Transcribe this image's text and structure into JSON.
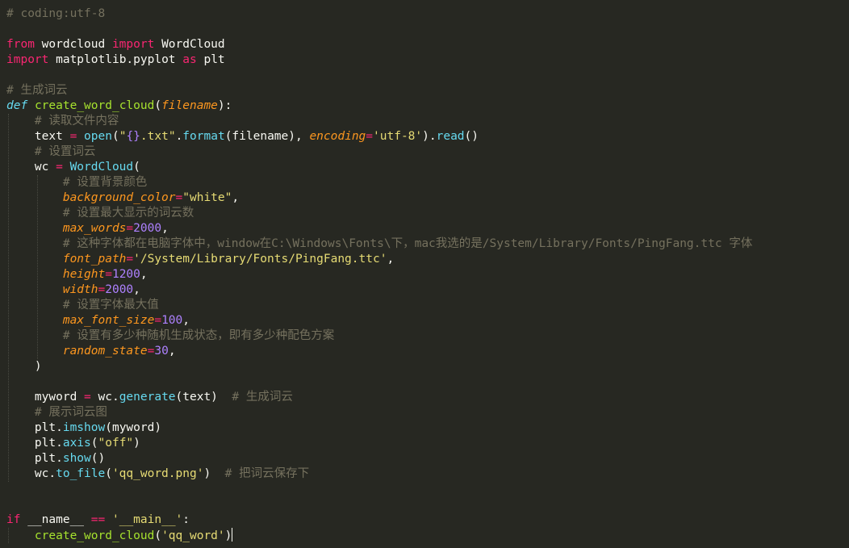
{
  "editor": {
    "lines": [
      {
        "tokens": [
          {
            "c": "cm",
            "t": "# coding:utf-8"
          }
        ]
      },
      {
        "tokens": []
      },
      {
        "tokens": [
          {
            "c": "kw",
            "t": "from"
          },
          {
            "c": "tx",
            "t": " wordcloud "
          },
          {
            "c": "kw",
            "t": "import"
          },
          {
            "c": "tx",
            "t": " WordCloud"
          }
        ]
      },
      {
        "tokens": [
          {
            "c": "kw",
            "t": "import"
          },
          {
            "c": "tx",
            "t": " matplotlib.pyplot "
          },
          {
            "c": "kw",
            "t": "as"
          },
          {
            "c": "tx",
            "t": " plt"
          }
        ]
      },
      {
        "tokens": []
      },
      {
        "tokens": [
          {
            "c": "cm",
            "t": "# 生成词云"
          }
        ]
      },
      {
        "tokens": [
          {
            "c": "df",
            "t": "def"
          },
          {
            "c": "tx",
            "t": " "
          },
          {
            "c": "fn",
            "t": "create_word_cloud"
          },
          {
            "c": "tx",
            "t": "("
          },
          {
            "c": "pa",
            "t": "filename"
          },
          {
            "c": "tx",
            "t": "):"
          }
        ]
      },
      {
        "tokens": [
          {
            "c": "tx",
            "t": "    "
          },
          {
            "c": "cm",
            "t": "# 读取文件内容"
          }
        ]
      },
      {
        "tokens": [
          {
            "c": "tx",
            "t": "    text "
          },
          {
            "c": "kw",
            "t": "="
          },
          {
            "c": "tx",
            "t": " "
          },
          {
            "c": "bi",
            "t": "open"
          },
          {
            "c": "tx",
            "t": "("
          },
          {
            "c": "st",
            "t": "\""
          },
          {
            "c": "nm",
            "t": "{}"
          },
          {
            "c": "st",
            "t": ".txt\""
          },
          {
            "c": "tx",
            "t": "."
          },
          {
            "c": "bi",
            "t": "format"
          },
          {
            "c": "tx",
            "t": "(filename), "
          },
          {
            "c": "pa",
            "t": "encoding"
          },
          {
            "c": "kw",
            "t": "="
          },
          {
            "c": "st",
            "t": "'utf-8'"
          },
          {
            "c": "tx",
            "t": ")."
          },
          {
            "c": "bi",
            "t": "read"
          },
          {
            "c": "tx",
            "t": "()"
          }
        ]
      },
      {
        "tokens": [
          {
            "c": "tx",
            "t": "    "
          },
          {
            "c": "cm",
            "t": "# 设置词云"
          }
        ]
      },
      {
        "tokens": [
          {
            "c": "tx",
            "t": "    wc "
          },
          {
            "c": "kw",
            "t": "="
          },
          {
            "c": "tx",
            "t": " "
          },
          {
            "c": "bi",
            "t": "WordCloud"
          },
          {
            "c": "tx",
            "t": "("
          }
        ]
      },
      {
        "tokens": [
          {
            "c": "tx",
            "t": "        "
          },
          {
            "c": "cm",
            "t": "# 设置背景颜色"
          }
        ]
      },
      {
        "tokens": [
          {
            "c": "tx",
            "t": "        "
          },
          {
            "c": "pa",
            "t": "background_color"
          },
          {
            "c": "kw",
            "t": "="
          },
          {
            "c": "st",
            "t": "\"white\""
          },
          {
            "c": "tx",
            "t": ","
          }
        ]
      },
      {
        "tokens": [
          {
            "c": "tx",
            "t": "        "
          },
          {
            "c": "cm",
            "t": "# 设置最大显示的词云数"
          }
        ]
      },
      {
        "tokens": [
          {
            "c": "tx",
            "t": "        "
          },
          {
            "c": "pa",
            "t": "max_words"
          },
          {
            "c": "kw",
            "t": "="
          },
          {
            "c": "nm",
            "t": "2000"
          },
          {
            "c": "tx",
            "t": ","
          }
        ]
      },
      {
        "tokens": [
          {
            "c": "tx",
            "t": "        "
          },
          {
            "c": "cm",
            "t": "# 这种字体都在电脑字体中，window在C:\\Windows\\Fonts\\下，mac我选的是/System/Library/Fonts/PingFang.ttc 字体"
          }
        ]
      },
      {
        "tokens": [
          {
            "c": "tx",
            "t": "        "
          },
          {
            "c": "pa",
            "t": "font_path"
          },
          {
            "c": "kw",
            "t": "="
          },
          {
            "c": "st",
            "t": "'/System/Library/Fonts/PingFang.ttc'"
          },
          {
            "c": "tx",
            "t": ","
          }
        ]
      },
      {
        "tokens": [
          {
            "c": "tx",
            "t": "        "
          },
          {
            "c": "pa",
            "t": "height"
          },
          {
            "c": "kw",
            "t": "="
          },
          {
            "c": "nm",
            "t": "1200"
          },
          {
            "c": "tx",
            "t": ","
          }
        ]
      },
      {
        "tokens": [
          {
            "c": "tx",
            "t": "        "
          },
          {
            "c": "pa",
            "t": "width"
          },
          {
            "c": "kw",
            "t": "="
          },
          {
            "c": "nm",
            "t": "2000"
          },
          {
            "c": "tx",
            "t": ","
          }
        ]
      },
      {
        "tokens": [
          {
            "c": "tx",
            "t": "        "
          },
          {
            "c": "cm",
            "t": "# 设置字体最大值"
          }
        ]
      },
      {
        "tokens": [
          {
            "c": "tx",
            "t": "        "
          },
          {
            "c": "pa",
            "t": "max_font_size"
          },
          {
            "c": "kw",
            "t": "="
          },
          {
            "c": "nm",
            "t": "100"
          },
          {
            "c": "tx",
            "t": ","
          }
        ]
      },
      {
        "tokens": [
          {
            "c": "tx",
            "t": "        "
          },
          {
            "c": "cm",
            "t": "# 设置有多少种随机生成状态，即有多少种配色方案"
          }
        ]
      },
      {
        "tokens": [
          {
            "c": "tx",
            "t": "        "
          },
          {
            "c": "pa",
            "t": "random_state"
          },
          {
            "c": "kw",
            "t": "="
          },
          {
            "c": "nm",
            "t": "30"
          },
          {
            "c": "tx",
            "t": ","
          }
        ]
      },
      {
        "tokens": [
          {
            "c": "tx",
            "t": "    )"
          }
        ]
      },
      {
        "tokens": []
      },
      {
        "tokens": [
          {
            "c": "tx",
            "t": "    myword "
          },
          {
            "c": "kw",
            "t": "="
          },
          {
            "c": "tx",
            "t": " wc."
          },
          {
            "c": "bi",
            "t": "generate"
          },
          {
            "c": "tx",
            "t": "(text)  "
          },
          {
            "c": "cm",
            "t": "# 生成词云"
          }
        ]
      },
      {
        "tokens": [
          {
            "c": "tx",
            "t": "    "
          },
          {
            "c": "cm",
            "t": "# 展示词云图"
          }
        ]
      },
      {
        "tokens": [
          {
            "c": "tx",
            "t": "    plt."
          },
          {
            "c": "bi",
            "t": "imshow"
          },
          {
            "c": "tx",
            "t": "(myword)"
          }
        ]
      },
      {
        "tokens": [
          {
            "c": "tx",
            "t": "    plt."
          },
          {
            "c": "bi",
            "t": "axis"
          },
          {
            "c": "tx",
            "t": "("
          },
          {
            "c": "st",
            "t": "\"off\""
          },
          {
            "c": "tx",
            "t": ")"
          }
        ]
      },
      {
        "tokens": [
          {
            "c": "tx",
            "t": "    plt."
          },
          {
            "c": "bi",
            "t": "show"
          },
          {
            "c": "tx",
            "t": "()"
          }
        ]
      },
      {
        "tokens": [
          {
            "c": "tx",
            "t": "    wc."
          },
          {
            "c": "bi",
            "t": "to_file"
          },
          {
            "c": "tx",
            "t": "("
          },
          {
            "c": "st",
            "t": "'qq_word.png'"
          },
          {
            "c": "tx",
            "t": ")  "
          },
          {
            "c": "cm",
            "t": "# 把词云保存下"
          }
        ]
      },
      {
        "tokens": []
      },
      {
        "tokens": []
      },
      {
        "tokens": [
          {
            "c": "kw",
            "t": "if"
          },
          {
            "c": "tx",
            "t": " __name__ "
          },
          {
            "c": "kw",
            "t": "=="
          },
          {
            "c": "tx",
            "t": " "
          },
          {
            "c": "st",
            "t": "'__main__'"
          },
          {
            "c": "tx",
            "t": ":"
          }
        ]
      },
      {
        "tokens": [
          {
            "c": "tx",
            "t": "    "
          },
          {
            "c": "fn",
            "t": "create_word_cloud"
          },
          {
            "c": "tx",
            "t": "("
          },
          {
            "c": "st",
            "t": "'qq_word'"
          },
          {
            "c": "tx",
            "t": ")"
          }
        ],
        "caret": true
      }
    ]
  }
}
